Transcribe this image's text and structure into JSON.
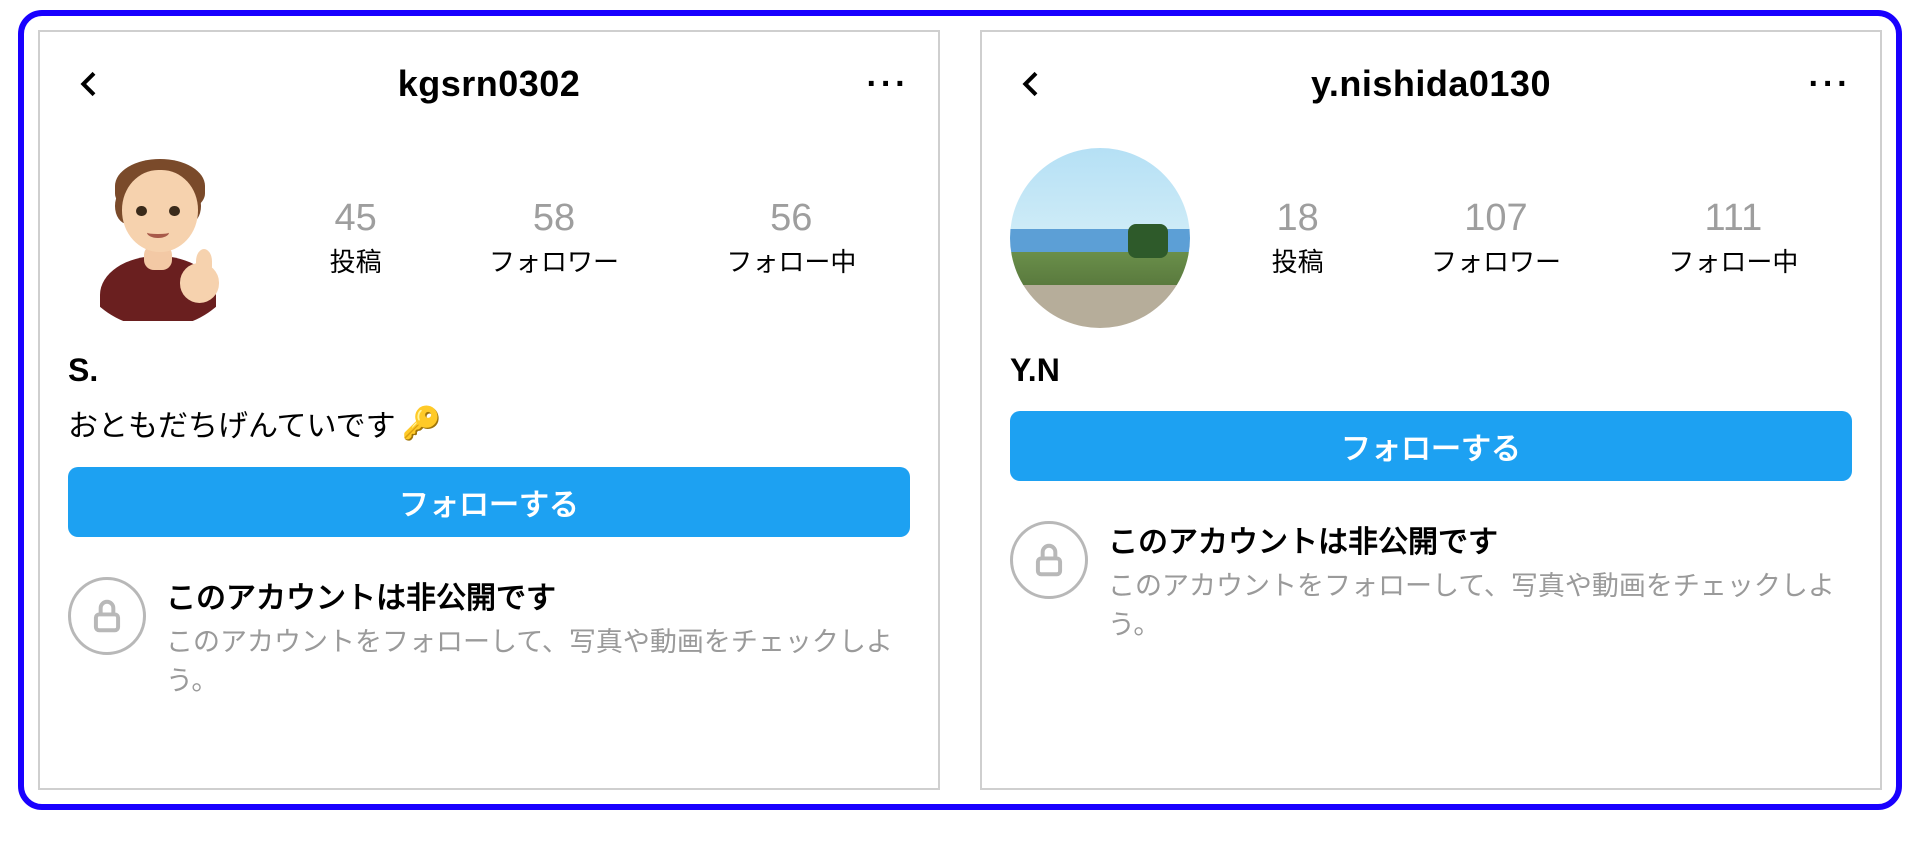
{
  "labels": {
    "posts": "投稿",
    "followers": "フォロワー",
    "following": "フォロー中",
    "follow_button": "フォローする",
    "private_title": "このアカウントは非公開です",
    "private_sub": "このアカウントをフォローして、写真や動画をチェックしよう。"
  },
  "profiles": [
    {
      "username": "kgsrn0302",
      "display_name": "S.",
      "bio_text": "おともだちげんていです",
      "bio_emoji": "🔑",
      "avatar_kind": "memoji",
      "stats": {
        "posts": "45",
        "followers": "58",
        "following": "56"
      }
    },
    {
      "username": "y.nishida0130",
      "display_name": "Y.N",
      "bio_text": "",
      "bio_emoji": "",
      "avatar_kind": "landscape",
      "stats": {
        "posts": "18",
        "followers": "107",
        "following": "111"
      }
    }
  ],
  "colors": {
    "frame_border": "#1900ff",
    "follow_button_bg": "#1da1f2",
    "muted_text": "#9e9e9e"
  }
}
